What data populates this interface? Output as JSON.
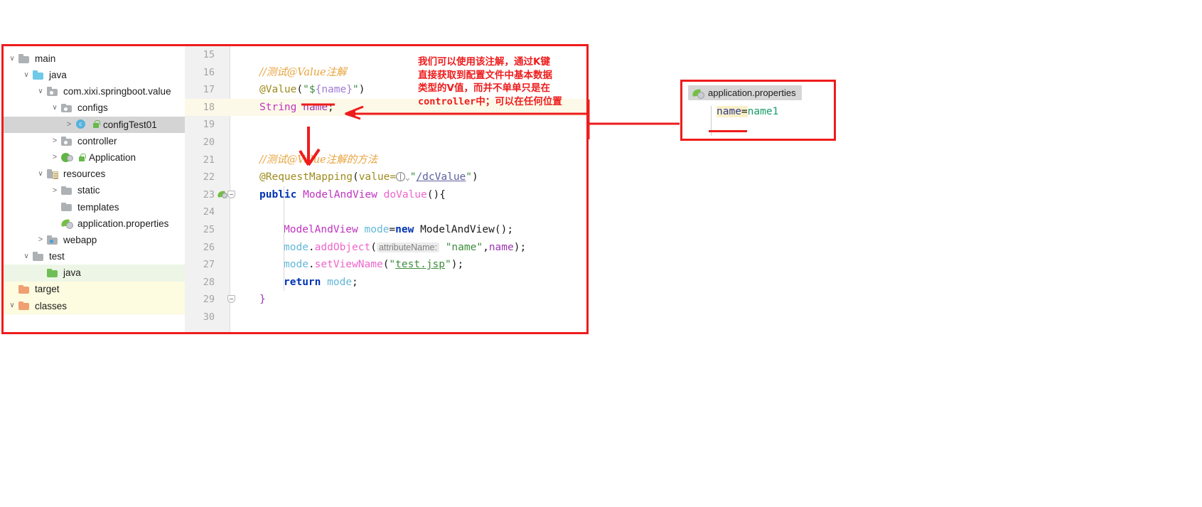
{
  "ide": {
    "project_tree": {
      "name": "project-tree",
      "items": [
        {
          "label": "main",
          "indent": 0,
          "chev": "down",
          "icon": "folder-gray-icon",
          "lock": false,
          "state": "none"
        },
        {
          "label": "java",
          "indent": 1,
          "chev": "down",
          "icon": "folder-blue-icon",
          "lock": false,
          "state": "none"
        },
        {
          "label": "com.xixi.springboot.value",
          "indent": 2,
          "chev": "down",
          "icon": "folder-package-icon",
          "lock": false,
          "state": "none"
        },
        {
          "label": "configs",
          "indent": 3,
          "chev": "down",
          "icon": "folder-package-icon",
          "lock": false,
          "state": "none"
        },
        {
          "label": "configTest01",
          "indent": 4,
          "chev": "right",
          "icon": "java-class-icon",
          "lock": true,
          "state": "selected"
        },
        {
          "label": "controller",
          "indent": 3,
          "chev": "right",
          "icon": "folder-package-icon",
          "lock": false,
          "state": "none"
        },
        {
          "label": "Application",
          "indent": 3,
          "chev": "right",
          "icon": "spring-boot-class-icon",
          "lock": true,
          "state": "none"
        },
        {
          "label": "resources",
          "indent": 2,
          "chev": "down",
          "icon": "folder-resources-icon",
          "lock": false,
          "state": "none"
        },
        {
          "label": "static",
          "indent": 3,
          "chev": "right",
          "icon": "folder-gray-icon",
          "lock": false,
          "state": "none"
        },
        {
          "label": "templates",
          "indent": 3,
          "chev": "none",
          "icon": "folder-gray-icon",
          "lock": false,
          "state": "none"
        },
        {
          "label": "application.properties",
          "indent": 3,
          "chev": "none",
          "icon": "spring-properties-icon",
          "lock": false,
          "state": "none"
        },
        {
          "label": "webapp",
          "indent": 2,
          "chev": "right",
          "icon": "folder-webapp-icon",
          "lock": false,
          "state": "none"
        },
        {
          "label": "test",
          "indent": 1,
          "chev": "down",
          "icon": "folder-gray-icon",
          "lock": false,
          "state": "none"
        },
        {
          "label": "java",
          "indent": 2,
          "chev": "none",
          "icon": "folder-green-icon",
          "lock": false,
          "state": "green"
        },
        {
          "label": "target",
          "indent": 0,
          "chev": "none",
          "icon": "folder-orange-icon",
          "lock": false,
          "state": "yellow"
        },
        {
          "label": "classes",
          "indent": 0,
          "chev": "down",
          "icon": "folder-orange-icon",
          "lock": false,
          "state": "yellow"
        }
      ]
    },
    "editor": {
      "name": "code-editor",
      "first_line_number": 15,
      "highlighted_line": 18,
      "lines": [
        {
          "n": 15,
          "tokens": []
        },
        {
          "n": 16,
          "tokens": [
            {
              "t": "cmt",
              "v": "//测试@Value注解"
            }
          ]
        },
        {
          "n": 17,
          "tokens": [
            {
              "t": "ann",
              "v": "@Value"
            },
            {
              "t": "brk",
              "v": "("
            },
            {
              "t": "str",
              "v": "\"$"
            },
            {
              "t": "tmpl-underlined",
              "v": "{name}"
            },
            {
              "t": "str",
              "v": "\""
            },
            {
              "t": "brk",
              "v": ")"
            }
          ]
        },
        {
          "n": 18,
          "tokens": [
            {
              "t": "type",
              "v": "String"
            },
            {
              "t": "plain",
              "v": " "
            },
            {
              "t": "field",
              "v": "name"
            },
            {
              "t": "plain",
              "v": ";"
            }
          ]
        },
        {
          "n": 19,
          "tokens": []
        },
        {
          "n": 20,
          "tokens": []
        },
        {
          "n": 21,
          "tokens": [
            {
              "t": "cmt",
              "v": "//测试@Value注解的方法"
            }
          ]
        },
        {
          "n": 22,
          "tokens": [
            {
              "t": "ann",
              "v": "@RequestMapping"
            },
            {
              "t": "brk",
              "v": "("
            },
            {
              "t": "ann",
              "v": "value="
            },
            {
              "t": "globe",
              "v": ""
            },
            {
              "t": "caret",
              "v": "⌄"
            },
            {
              "t": "str",
              "v": "\""
            },
            {
              "t": "link",
              "v": "/dcValue"
            },
            {
              "t": "str",
              "v": "\""
            },
            {
              "t": "brk",
              "v": ")"
            }
          ]
        },
        {
          "n": 23,
          "badge": "spring-bean-gutter-icon",
          "fold": "open",
          "tokens": [
            {
              "t": "kw",
              "v": "public"
            },
            {
              "t": "plain",
              "v": " "
            },
            {
              "t": "type",
              "v": "ModelAndView"
            },
            {
              "t": "plain",
              "v": " "
            },
            {
              "t": "meth",
              "v": "doValue"
            },
            {
              "t": "brk",
              "v": "(){"
            }
          ]
        },
        {
          "n": 24,
          "tokens": []
        },
        {
          "n": 25,
          "indent": 1,
          "tokens": [
            {
              "t": "type",
              "v": "ModelAndView"
            },
            {
              "t": "plain",
              "v": " "
            },
            {
              "t": "var",
              "v": "mode"
            },
            {
              "t": "plain",
              "v": "="
            },
            {
              "t": "kw",
              "v": "new"
            },
            {
              "t": "plain",
              "v": " "
            },
            {
              "t": "type-plain",
              "v": "ModelAndView"
            },
            {
              "t": "brk",
              "v": "();"
            }
          ]
        },
        {
          "n": 26,
          "indent": 1,
          "tokens": [
            {
              "t": "var",
              "v": "mode"
            },
            {
              "t": "plain",
              "v": "."
            },
            {
              "t": "meth",
              "v": "addObject"
            },
            {
              "t": "brk",
              "v": "("
            },
            {
              "t": "hint",
              "v": "attributeName:"
            },
            {
              "t": "plain",
              "v": " "
            },
            {
              "t": "str",
              "v": "\"name\""
            },
            {
              "t": "plain",
              "v": ","
            },
            {
              "t": "field",
              "v": "name"
            },
            {
              "t": "brk",
              "v": ");"
            }
          ]
        },
        {
          "n": 27,
          "indent": 1,
          "tokens": [
            {
              "t": "var",
              "v": "mode"
            },
            {
              "t": "plain",
              "v": "."
            },
            {
              "t": "meth",
              "v": "setViewName"
            },
            {
              "t": "brk",
              "v": "("
            },
            {
              "t": "str",
              "v": "\""
            },
            {
              "t": "strlink",
              "v": "test.jsp"
            },
            {
              "t": "str",
              "v": "\""
            },
            {
              "t": "brk",
              "v": ");"
            }
          ]
        },
        {
          "n": 28,
          "indent": 1,
          "tokens": [
            {
              "t": "kw",
              "v": "return"
            },
            {
              "t": "plain",
              "v": " "
            },
            {
              "t": "var",
              "v": "mode"
            },
            {
              "t": "plain",
              "v": ";"
            }
          ]
        },
        {
          "n": 29,
          "fold": "open",
          "tokens": [
            {
              "t": "field",
              "v": "}"
            }
          ]
        },
        {
          "n": 30,
          "tokens": []
        }
      ]
    }
  },
  "annotation": {
    "name": "red-annotation-note",
    "lines": [
      "我们可以使用该注解，通过K键",
      "直接获取到配置文件中基本数据",
      "类型的V值，而并不单单只是在",
      "controller中；可以在任何位置"
    ],
    "color": "#ee1c1c"
  },
  "properties_panel": {
    "name": "application-properties-popup",
    "tab_label": "application.properties",
    "tab_icon": "spring-properties-icon",
    "entry": {
      "key": "name",
      "separator": "=",
      "value": "name1"
    },
    "border_color": "#ee1c1c"
  },
  "colors": {
    "annotation_red": "#ee1c1c",
    "selection_gray": "#d4d4d4",
    "line_highlight": "#fdf9e8",
    "gutter_bg": "#f1f1f1",
    "tree_green": "#edf6e6",
    "tree_yellow": "#fdfbe0"
  }
}
